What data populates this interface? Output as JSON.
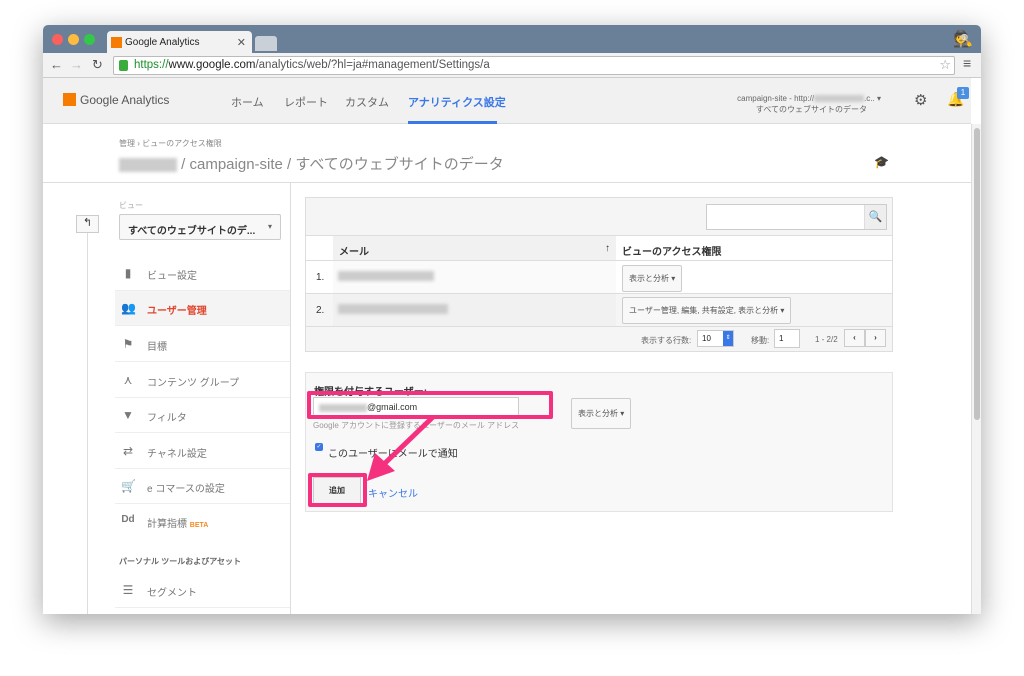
{
  "browser": {
    "tab_title": "Google Analytics",
    "url_scheme": "https://",
    "url_domain": "www.google.com",
    "url_path": "/analytics/web/?hl=ja#management/Settings/a"
  },
  "header": {
    "logo": "Google Analytics",
    "menu": [
      "ホーム",
      "レポート",
      "カスタム",
      "アナリティクス設定"
    ],
    "active_menu": "アナリティクス設定",
    "account_line1": "campaign-site - http://",
    "account_line1_suffix": ".c..",
    "account_line2": "すべてのウェブサイトのデータ",
    "notification_count": "1"
  },
  "page": {
    "breadcrumb": "管理 › ビューのアクセス権限",
    "title": "/ campaign-site / すべてのウェブサイトのデータ"
  },
  "sidebar": {
    "view_label": "ビュー",
    "view_selected": "すべてのウェブサイトのデ...",
    "items": [
      {
        "icon": "document-icon",
        "label": "ビュー設定"
      },
      {
        "icon": "users-icon",
        "label": "ユーザー管理",
        "active": true
      },
      {
        "icon": "flag-icon",
        "label": "目標"
      },
      {
        "icon": "content-group-icon",
        "label": "コンテンツ グループ"
      },
      {
        "icon": "filter-icon",
        "label": "フィルタ"
      },
      {
        "icon": "channel-icon",
        "label": "チャネル設定"
      },
      {
        "icon": "cart-icon",
        "label": "e コマースの設定"
      },
      {
        "icon": "dd-icon",
        "label": "計算指標",
        "badge": "BETA"
      }
    ],
    "section": "パーソナル ツールおよびアセット",
    "section_items": [
      {
        "icon": "segment-icon",
        "label": "セグメント"
      }
    ]
  },
  "table": {
    "headers": [
      "メール",
      "ビューのアクセス権限"
    ],
    "rows": [
      {
        "num": "1.",
        "permission": "表示と分析"
      },
      {
        "num": "2.",
        "permission": "ユーザー管理, 編集, 共有設定, 表示と分析"
      }
    ],
    "rows_label": "表示する行数:",
    "rows_value": "10",
    "goto_label": "移動:",
    "goto_value": "1",
    "range": "1 - 2/2"
  },
  "form": {
    "title": "権限を付与するユーザー:",
    "email_value": "@gmail.com",
    "hint": "Google アカウントに登録するユーザーのメール アドレス",
    "permission": "表示と分析",
    "notify_label": "このユーザーにメールで通知",
    "notify_checked": true,
    "add_button": "追加",
    "cancel_link": "キャンセル"
  },
  "colors": {
    "accent": "#3a78e6",
    "active_item": "#e0462f",
    "highlight": "#f5317f"
  }
}
